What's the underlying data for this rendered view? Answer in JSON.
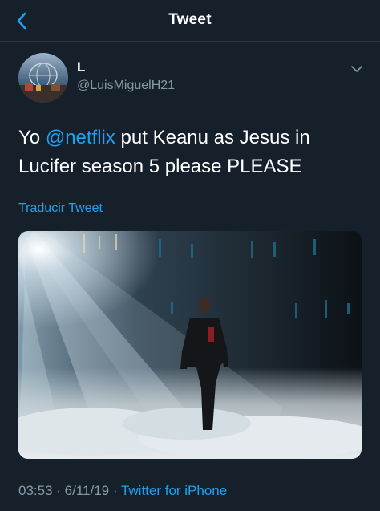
{
  "header": {
    "title": "Tweet",
    "back_icon": "chevron-left-icon"
  },
  "author": {
    "name": "L",
    "handle": "@LuisMiguelH21"
  },
  "tweet": {
    "text_before": "Yo ",
    "mention": "@netflix",
    "text_after": " put Keanu as Jesus in Lucifer season 5 please PLEASE"
  },
  "translate_label": "Traducir Tweet",
  "meta": {
    "time": "03:53",
    "sep1": " · ",
    "date": "6/11/19",
    "sep2": " · ",
    "client": "Twitter for iPhone"
  },
  "colors": {
    "background": "#15202b",
    "accent": "#1da1f2",
    "secondary_text": "#8899a6"
  }
}
